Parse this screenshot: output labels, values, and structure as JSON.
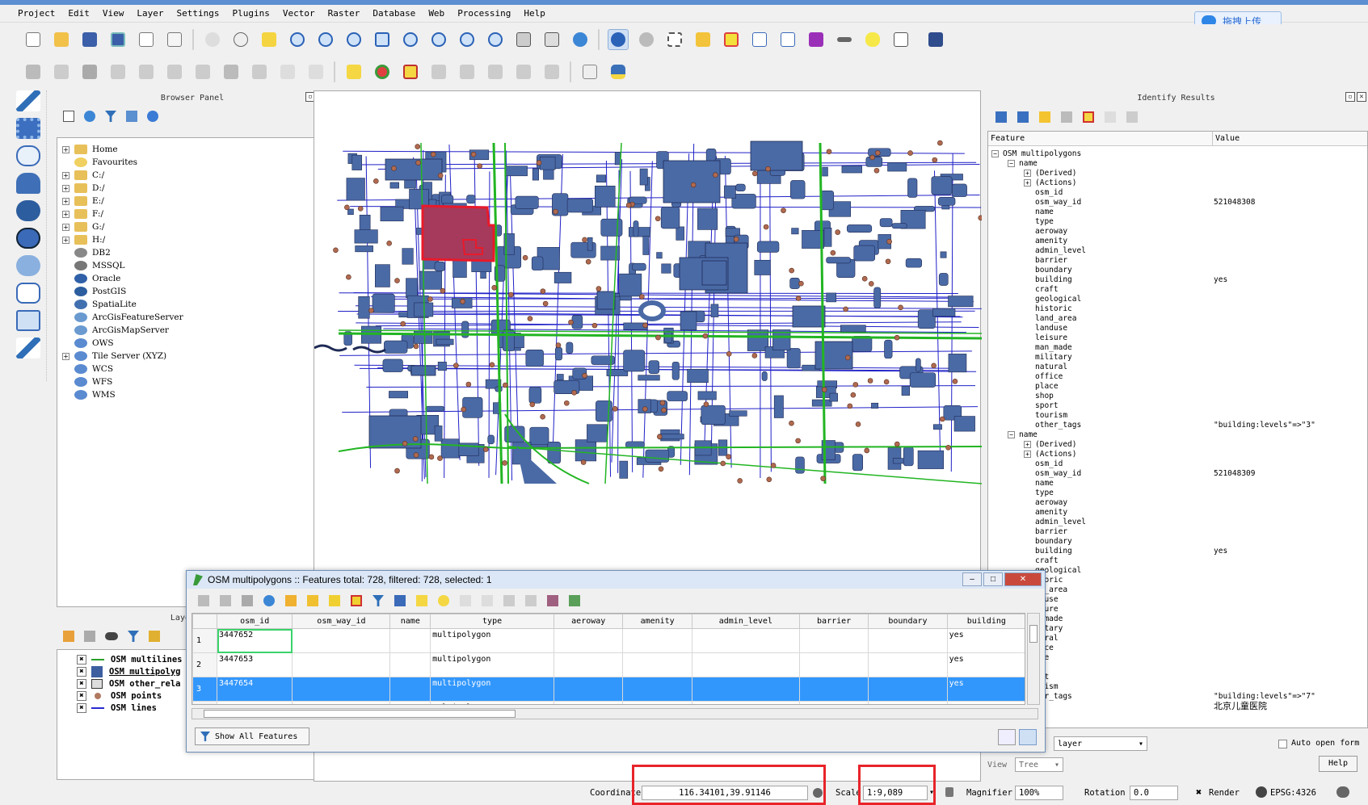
{
  "menu": [
    "Project",
    "Edit",
    "View",
    "Layer",
    "Settings",
    "Plugins",
    "Vector",
    "Raster",
    "Database",
    "Web",
    "Processing",
    "Help"
  ],
  "upload_label": "拖拽上传",
  "browser": {
    "title": "Browser Panel",
    "items": [
      {
        "label": "Home",
        "icon": "folder-icon",
        "exp": true
      },
      {
        "label": "Favourites",
        "icon": "star-icon",
        "exp": false
      },
      {
        "label": "C:/",
        "icon": "folder-icon",
        "exp": true
      },
      {
        "label": "D:/",
        "icon": "folder-icon",
        "exp": true
      },
      {
        "label": "E:/",
        "icon": "folder-icon",
        "exp": true
      },
      {
        "label": "F:/",
        "icon": "folder-icon",
        "exp": true
      },
      {
        "label": "G:/",
        "icon": "folder-icon",
        "exp": true
      },
      {
        "label": "H:/",
        "icon": "folder-icon",
        "exp": true
      },
      {
        "label": "DB2",
        "icon": "db2-icon",
        "exp": false
      },
      {
        "label": "MSSQL",
        "icon": "mssql-icon",
        "exp": false
      },
      {
        "label": "Oracle",
        "icon": "oracle-icon",
        "exp": false
      },
      {
        "label": "PostGIS",
        "icon": "postgis-icon",
        "exp": false
      },
      {
        "label": "SpatiaLite",
        "icon": "spatialite-icon",
        "exp": false
      },
      {
        "label": "ArcGisFeatureServer",
        "icon": "arcgis-icon",
        "exp": false
      },
      {
        "label": "ArcGisMapServer",
        "icon": "arcgis-icon",
        "exp": false
      },
      {
        "label": "OWS",
        "icon": "globe-icon",
        "exp": false
      },
      {
        "label": "Tile Server (XYZ)",
        "icon": "globe-icon",
        "exp": true
      },
      {
        "label": "WCS",
        "icon": "globe-icon",
        "exp": false
      },
      {
        "label": "WFS",
        "icon": "globe-icon",
        "exp": false
      },
      {
        "label": "WMS",
        "icon": "globe-icon",
        "exp": false
      }
    ]
  },
  "layers": {
    "title": "Layers Pa",
    "items": [
      {
        "label": "OSM multilines",
        "symbol": "line",
        "color": "#2aa02a"
      },
      {
        "label": "OSM multipolyg",
        "symbol": "fill",
        "color": "#3d5fa0"
      },
      {
        "label": "OSM other_rela",
        "symbol": "raster",
        "color": "#444"
      },
      {
        "label": "OSM points",
        "symbol": "point",
        "color": "#b07a60"
      },
      {
        "label": "OSM lines",
        "symbol": "line",
        "color": "#2a2ad0"
      }
    ]
  },
  "identify": {
    "title": "Identify Results",
    "col_feature": "Feature",
    "col_value": "Value",
    "root": "OSM multipolygons",
    "groups": [
      {
        "name": "name",
        "derived": "(Derived)",
        "actions": "(Actions)",
        "fields": [
          [
            "osm_id",
            ""
          ],
          [
            "osm_way_id",
            "521048308"
          ],
          [
            "name",
            ""
          ],
          [
            "type",
            ""
          ],
          [
            "aeroway",
            ""
          ],
          [
            "amenity",
            ""
          ],
          [
            "admin_level",
            ""
          ],
          [
            "barrier",
            ""
          ],
          [
            "boundary",
            ""
          ],
          [
            "building",
            "yes"
          ],
          [
            "craft",
            ""
          ],
          [
            "geological",
            ""
          ],
          [
            "historic",
            ""
          ],
          [
            "land_area",
            ""
          ],
          [
            "landuse",
            ""
          ],
          [
            "leisure",
            ""
          ],
          [
            "man_made",
            ""
          ],
          [
            "military",
            ""
          ],
          [
            "natural",
            ""
          ],
          [
            "office",
            ""
          ],
          [
            "place",
            ""
          ],
          [
            "shop",
            ""
          ],
          [
            "sport",
            ""
          ],
          [
            "tourism",
            ""
          ],
          [
            "other_tags",
            "\"building:levels\"=>\"3\""
          ]
        ]
      },
      {
        "name": "name",
        "derived": "(Derived)",
        "actions": "(Actions)",
        "fields": [
          [
            "osm_id",
            ""
          ],
          [
            "osm_way_id",
            "521048309"
          ],
          [
            "name",
            ""
          ],
          [
            "type",
            ""
          ],
          [
            "aeroway",
            ""
          ],
          [
            "amenity",
            ""
          ],
          [
            "admin_level",
            ""
          ],
          [
            "barrier",
            ""
          ],
          [
            "boundary",
            ""
          ],
          [
            "building",
            "yes"
          ],
          [
            "craft",
            ""
          ],
          [
            "geological",
            ""
          ],
          [
            "storic",
            ""
          ],
          [
            "nd_area",
            ""
          ],
          [
            "nduse",
            ""
          ],
          [
            "isure",
            ""
          ],
          [
            "n_made",
            ""
          ],
          [
            "litary",
            ""
          ],
          [
            "tural",
            ""
          ],
          [
            "fice",
            ""
          ],
          [
            "ace",
            ""
          ],
          [
            "op",
            ""
          ],
          [
            "ort",
            ""
          ],
          [
            "urism",
            ""
          ],
          [
            "her_tags",
            "\"building:levels\"=>\"7\""
          ]
        ]
      }
    ],
    "extra_value": "北京儿童医院",
    "mode_label": "layer",
    "auto_open": "Auto open form",
    "view_label": "View",
    "view_value": "Tree",
    "help": "Help"
  },
  "attr": {
    "title": "OSM multipolygons :: Features total: 728, filtered: 728, selected: 1",
    "columns": [
      "osm_id",
      "osm_way_id",
      "name",
      "type",
      "aeroway",
      "amenity",
      "admin_level",
      "barrier",
      "boundary",
      "building"
    ],
    "rows": [
      {
        "n": "1",
        "osm_id": "3447652",
        "type": "multipolygon",
        "building": "yes",
        "selected": false
      },
      {
        "n": "2",
        "osm_id": "3447653",
        "type": "multipolygon",
        "building": "yes",
        "selected": false
      },
      {
        "n": "3",
        "osm_id": "3447654",
        "type": "multipolygon",
        "building": "yes",
        "selected": true
      }
    ],
    "partial_row_type": "multipolygon",
    "show_all": "Show All Features"
  },
  "status": {
    "coord_label": "Coordinate",
    "coord_value": "116.34101,39.91146",
    "scale_label": "Scale",
    "scale_value": "1:9,089",
    "magnifier_label": "Magnifier",
    "magnifier_value": "100%",
    "rotation_label": "Rotation",
    "rotation_value": "0.0",
    "render_label": "Render",
    "crs": "EPSG:4326"
  },
  "colors": {
    "building": "#4a6aa6",
    "road_green": "#22b522",
    "road_blue": "#2020c8",
    "selection": "#e81a2a",
    "point": "#b06a50"
  }
}
